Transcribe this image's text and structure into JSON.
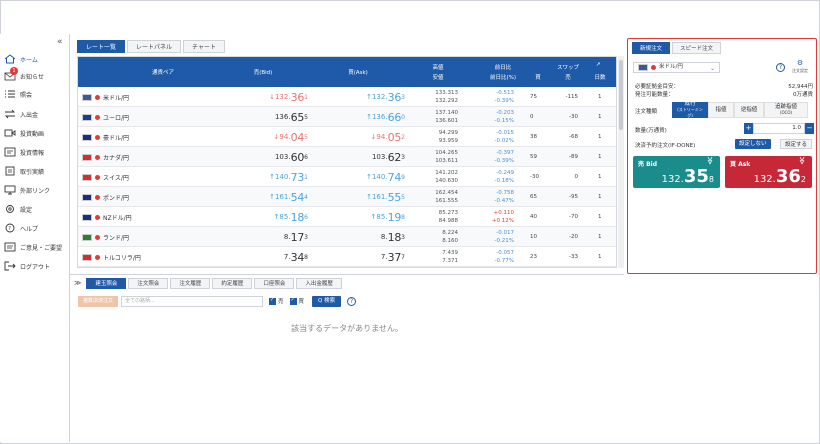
{
  "sidebar": {
    "collapse_icon": "«",
    "items": [
      {
        "label": "ホーム",
        "icon": "home-icon",
        "active": true
      },
      {
        "label": "お知らせ",
        "icon": "mail-icon",
        "badge": "1"
      },
      {
        "label": "照会",
        "icon": "list-icon"
      },
      {
        "label": "入出金",
        "icon": "transfer-icon"
      },
      {
        "label": "投資動画",
        "icon": "video-icon"
      },
      {
        "label": "投資情報",
        "icon": "news-icon"
      },
      {
        "label": "取引実績",
        "icon": "document-icon"
      },
      {
        "label": "外部リンク",
        "icon": "monitor-icon"
      },
      {
        "label": "設定",
        "icon": "gear-icon"
      },
      {
        "label": "ヘルプ",
        "icon": "help-icon"
      },
      {
        "label": "ご意見・ご要望",
        "icon": "feedback-icon"
      },
      {
        "label": "ログアウト",
        "icon": "logout-icon"
      }
    ]
  },
  "main_tabs": [
    "レート一覧",
    "レートパネル",
    "チャート"
  ],
  "rate_table": {
    "headers": {
      "pair": "通貨ペア",
      "bid": "売(Bid)",
      "ask": "買(Ask)",
      "high": "高値",
      "low": "安値",
      "chg": "前日比",
      "chg_pct": "前日比(%)",
      "swap": "スワップ",
      "swap_buy": "買",
      "swap_sell": "売",
      "days": "日数"
    },
    "rows": [
      {
        "pair": "米ドル/円",
        "flag": "#3c5a99",
        "bid_s": "132.",
        "bid_b": "36",
        "bid_t": "1",
        "bid_dir": "dn",
        "ask_s": "132.",
        "ask_b": "36",
        "ask_t": "3",
        "ask_dir": "up",
        "high": "133.313",
        "low": "132.292",
        "chg": "-0.513",
        "chg_pct": "-0.39%",
        "chg_sign": "neg",
        "swap_buy": "75",
        "swap_sell": "-115",
        "days": "1"
      },
      {
        "pair": "ユーロ/円",
        "flag": "#1e3c8c",
        "bid_s": "136.",
        "bid_b": "65",
        "bid_t": "5",
        "bid_dir": "flat",
        "ask_s": "136.",
        "ask_b": "66",
        "ask_t": "0",
        "ask_dir": "up",
        "high": "137.140",
        "low": "136.601",
        "chg": "-0.203",
        "chg_pct": "-0.15%",
        "chg_sign": "neg",
        "swap_buy": "0",
        "swap_sell": "-30",
        "days": "1"
      },
      {
        "pair": "豪ドル/円",
        "flag": "#1a2f7a",
        "bid_s": "94.",
        "bid_b": "04",
        "bid_t": "5",
        "bid_dir": "dn",
        "ask_s": "94.",
        "ask_b": "05",
        "ask_t": "2",
        "ask_dir": "dn",
        "high": "94.299",
        "low": "93.959",
        "chg": "-0.015",
        "chg_pct": "-0.02%",
        "chg_sign": "neg",
        "swap_buy": "38",
        "swap_sell": "-68",
        "days": "1"
      },
      {
        "pair": "カナダ/円",
        "flag": "#d32f2f",
        "bid_s": "103.",
        "bid_b": "60",
        "bid_t": "6",
        "bid_dir": "flat",
        "ask_s": "103.",
        "ask_b": "62",
        "ask_t": "3",
        "ask_dir": "flat",
        "high": "104.265",
        "low": "103.611",
        "chg": "-0.397",
        "chg_pct": "-0.39%",
        "chg_sign": "neg",
        "swap_buy": "59",
        "swap_sell": "-89",
        "days": "1"
      },
      {
        "pair": "スイス/円",
        "flag": "#d32f2f",
        "bid_s": "140.",
        "bid_b": "73",
        "bid_t": "1",
        "bid_dir": "up",
        "ask_s": "140.",
        "ask_b": "74",
        "ask_t": "9",
        "ask_dir": "up",
        "high": "141.202",
        "low": "140.630",
        "chg": "-0.249",
        "chg_pct": "-0.18%",
        "chg_sign": "neg",
        "swap_buy": "-30",
        "swap_sell": "0",
        "days": "1"
      },
      {
        "pair": "ポンド/円",
        "flag": "#1a2f7a",
        "bid_s": "161.",
        "bid_b": "54",
        "bid_t": "4",
        "bid_dir": "up",
        "ask_s": "161.",
        "ask_b": "55",
        "ask_t": "5",
        "ask_dir": "up",
        "high": "162.454",
        "low": "161.555",
        "chg": "-0.758",
        "chg_pct": "-0.47%",
        "chg_sign": "neg",
        "swap_buy": "65",
        "swap_sell": "-95",
        "days": "1"
      },
      {
        "pair": "NZドル/円",
        "flag": "#1a2f7a",
        "bid_s": "85.",
        "bid_b": "18",
        "bid_t": "6",
        "bid_dir": "up",
        "ask_s": "85.",
        "ask_b": "19",
        "ask_t": "8",
        "ask_dir": "up",
        "high": "85.273",
        "low": "84.988",
        "chg": "+0.110",
        "chg_pct": "+0.12%",
        "chg_sign": "pos",
        "swap_buy": "40",
        "swap_sell": "-70",
        "days": "1"
      },
      {
        "pair": "ランド/円",
        "flag": "#2e7d32",
        "bid_s": "8.",
        "bid_b": "17",
        "bid_t": "3",
        "bid_dir": "flat",
        "ask_s": "8.",
        "ask_b": "18",
        "ask_t": "3",
        "ask_dir": "flat",
        "high": "8.224",
        "low": "8.160",
        "chg": "-0.017",
        "chg_pct": "-0.21%",
        "chg_sign": "neg",
        "swap_buy": "10",
        "swap_sell": "-20",
        "days": "1"
      },
      {
        "pair": "トルコリラ/円",
        "flag": "#d32f2f",
        "bid_s": "7.",
        "bid_b": "34",
        "bid_t": "8",
        "bid_dir": "flat",
        "ask_s": "7.",
        "ask_b": "37",
        "ask_t": "7",
        "ask_dir": "flat",
        "high": "7.439",
        "low": "7.371",
        "chg": "-0.057",
        "chg_pct": "-0.77%",
        "chg_sign": "neg",
        "swap_buy": "23",
        "swap_sell": "-33",
        "days": "1"
      }
    ]
  },
  "bottom": {
    "toggle_icon": "≫",
    "tabs": [
      "建玉照会",
      "注文照会",
      "注文履歴",
      "約定履歴",
      "口座照会",
      "入出金履歴"
    ],
    "bulk_button": "複数決済注文",
    "search_placeholder": "全ての銘柄...",
    "check_sell": "売",
    "check_buy": "買",
    "search_button": "Q 検索",
    "help_icon": "?",
    "empty_message": "該当するデータがありません。"
  },
  "order_panel": {
    "tabs": [
      "新規注文",
      "スピード注文"
    ],
    "pair": "米ドル/円",
    "help_icon": "?",
    "settings_label": "注文設定",
    "margin_label": "必要証拠金目安：",
    "margin_value": "52,944円",
    "available_label": "発注可能数量：",
    "available_value": "0万通貨",
    "order_type_label": "注文種類",
    "order_types": [
      {
        "label": "成行",
        "sub": "(ストリーミング)",
        "active": true
      },
      {
        "label": "指値",
        "sub": ""
      },
      {
        "label": "逆指値",
        "sub": ""
      },
      {
        "label": "追跡指値",
        "sub": "(OCO)"
      }
    ],
    "qty_label": "数量(万通貨)",
    "qty_value": "1.0",
    "qty_plus": "+",
    "qty_minus": "−",
    "ifd_label": "決済予約注文(IF-DONE)",
    "ifd_off": "設定しない",
    "ifd_on": "設定する",
    "sell": {
      "label": "売 Bid",
      "small": "132.",
      "big": "35",
      "tiny": "8"
    },
    "buy": {
      "label": "買 Ask",
      "small": "132.",
      "big": "36",
      "tiny": "2"
    },
    "chevron": "≫"
  },
  "colors": {
    "accent": "#1f5aa8",
    "sell": "#1a8c8c",
    "buy": "#c62838",
    "highlight": "#e53935"
  }
}
